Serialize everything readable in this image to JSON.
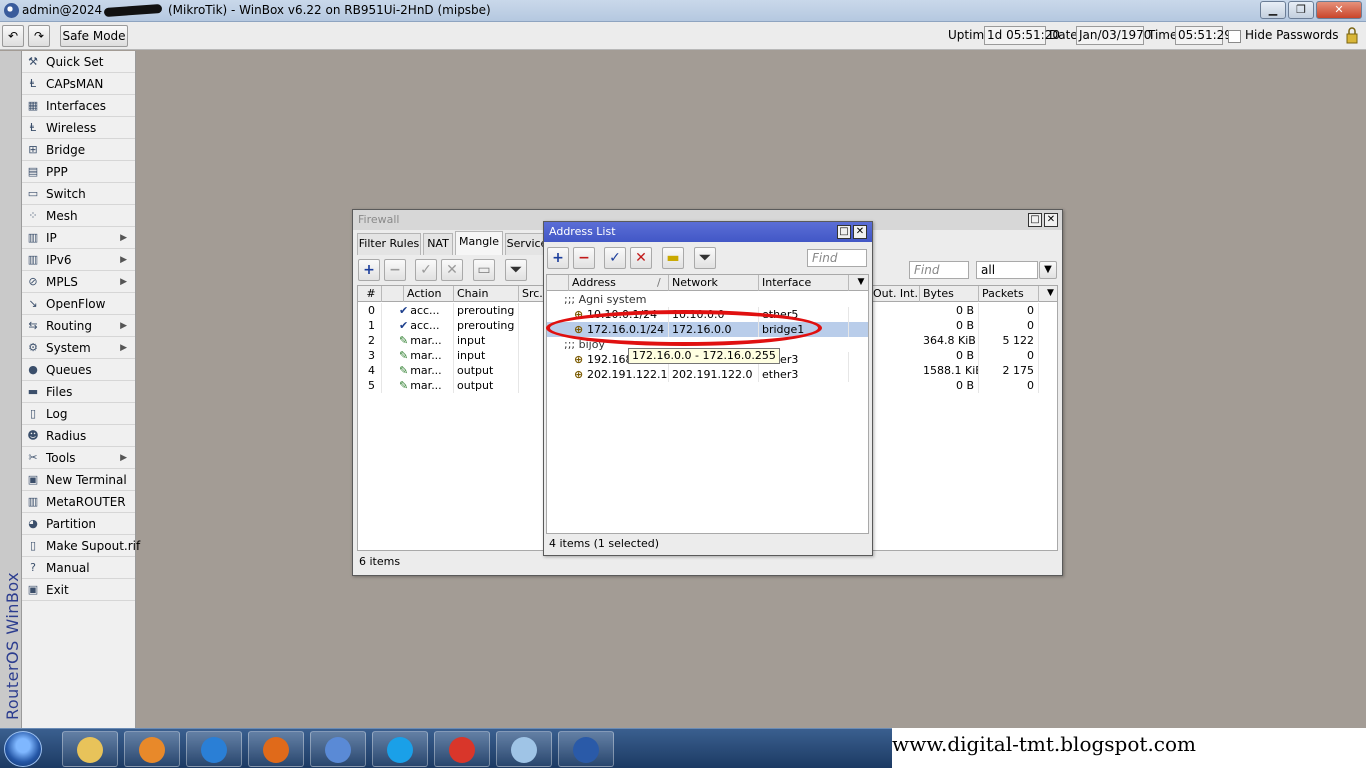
{
  "window": {
    "title_prefix": "admin@2024",
    "title_suffix": "(MikroTik) - WinBox v6.22 on RB951Ui-2HnD (mipsbe)",
    "btn_min": "▁",
    "btn_max": "❐",
    "btn_close": "✕"
  },
  "toolbar": {
    "undo_icon": "undo-icon",
    "redo_icon": "redo-icon",
    "undo_glyph": "↶",
    "redo_glyph": "↷",
    "safe_mode": "Safe Mode",
    "uptime_label": "Uptime:",
    "uptime_value": "1d 05:51:20",
    "date_label": "Date:",
    "date_value": "Jan/03/1970",
    "time_label": "Time:",
    "time_value": "05:51:29",
    "hide_passwords": "Hide Passwords"
  },
  "brand": {
    "text": "RouterOS WinBox"
  },
  "sidebar": {
    "items": [
      {
        "label": "Quick Set",
        "icon": "quick-set-icon",
        "glyph": "⚒"
      },
      {
        "label": "CAPsMAN",
        "icon": "capsman-icon",
        "glyph": "Ⱡ"
      },
      {
        "label": "Interfaces",
        "icon": "interfaces-icon",
        "glyph": "▦"
      },
      {
        "label": "Wireless",
        "icon": "wireless-icon",
        "glyph": "Ⱡ"
      },
      {
        "label": "Bridge",
        "icon": "bridge-icon",
        "glyph": "⊞"
      },
      {
        "label": "PPP",
        "icon": "ppp-icon",
        "glyph": "▤"
      },
      {
        "label": "Switch",
        "icon": "switch-icon",
        "glyph": "▭"
      },
      {
        "label": "Mesh",
        "icon": "mesh-icon",
        "glyph": "⁘"
      },
      {
        "label": "IP",
        "icon": "ip-icon",
        "glyph": "▥",
        "arrow": "▶"
      },
      {
        "label": "IPv6",
        "icon": "ipv6-icon",
        "glyph": "▥",
        "arrow": "▶"
      },
      {
        "label": "MPLS",
        "icon": "mpls-icon",
        "glyph": "⊘",
        "arrow": "▶"
      },
      {
        "label": "OpenFlow",
        "icon": "openflow-icon",
        "glyph": "↘"
      },
      {
        "label": "Routing",
        "icon": "routing-icon",
        "glyph": "⇆",
        "arrow": "▶"
      },
      {
        "label": "System",
        "icon": "system-icon",
        "glyph": "⚙",
        "arrow": "▶"
      },
      {
        "label": "Queues",
        "icon": "queues-icon",
        "glyph": "●"
      },
      {
        "label": "Files",
        "icon": "files-icon",
        "glyph": "▬"
      },
      {
        "label": "Log",
        "icon": "log-icon",
        "glyph": "▯"
      },
      {
        "label": "Radius",
        "icon": "radius-icon",
        "glyph": "☻"
      },
      {
        "label": "Tools",
        "icon": "tools-icon",
        "glyph": "✂",
        "arrow": "▶"
      },
      {
        "label": "New Terminal",
        "icon": "terminal-icon",
        "glyph": "▣"
      },
      {
        "label": "MetaROUTER",
        "icon": "metarouter-icon",
        "glyph": "▥"
      },
      {
        "label": "Partition",
        "icon": "partition-icon",
        "glyph": "◕"
      },
      {
        "label": "Make Supout.rif",
        "icon": "supout-icon",
        "glyph": "▯"
      },
      {
        "label": "Manual",
        "icon": "manual-icon",
        "glyph": "?"
      },
      {
        "label": "Exit",
        "icon": "exit-icon",
        "glyph": "▣"
      }
    ]
  },
  "firewall": {
    "title": "Firewall",
    "tabs": [
      "Filter Rules",
      "NAT",
      "Mangle",
      "Service"
    ],
    "active_tab": "Mangle",
    "find_placeholder": "Find",
    "filter_select": "all",
    "columns": [
      "#",
      "Action",
      "Chain",
      "Src.",
      "Out. Int...",
      "Bytes",
      "Packets"
    ],
    "rows": [
      {
        "num": "0",
        "action": "acc...",
        "action_type": "accept",
        "chain": "prerouting",
        "bytes": "0 B",
        "packets": "0"
      },
      {
        "num": "1",
        "action": "acc...",
        "action_type": "accept",
        "chain": "prerouting",
        "bytes": "0 B",
        "packets": "0"
      },
      {
        "num": "2",
        "action": "mar...",
        "action_type": "mark",
        "chain": "input",
        "bytes": "364.8 KiB",
        "packets": "5 122"
      },
      {
        "num": "3",
        "action": "mar...",
        "action_type": "mark",
        "chain": "input",
        "bytes": "0 B",
        "packets": "0"
      },
      {
        "num": "4",
        "action": "mar...",
        "action_type": "mark",
        "chain": "output",
        "bytes": "1588.1 KiB",
        "packets": "2 175"
      },
      {
        "num": "5",
        "action": "mar...",
        "action_type": "mark",
        "chain": "output",
        "bytes": "0 B",
        "packets": "0"
      }
    ],
    "status": "6 items"
  },
  "address_list": {
    "title": "Address List",
    "find_placeholder": "Find",
    "columns": [
      "Address",
      "Network",
      "Interface"
    ],
    "sort_indicator": "/",
    "rows": [
      {
        "type": "comment",
        "text": ";;; Agni system"
      },
      {
        "type": "item",
        "address": "10.10.0.1/24",
        "network": "10.10.0.0",
        "interface": "ether5"
      },
      {
        "type": "item",
        "address": "172.16.0.1/24",
        "network": "172.16.0.0",
        "interface": "bridge1",
        "selected": true
      },
      {
        "type": "comment",
        "text": ";;; bijoy"
      },
      {
        "type": "item",
        "address": "192.168",
        "network": "",
        "interface": "ether3"
      },
      {
        "type": "item",
        "address": "202.191.122.1...",
        "network": "202.191.122.0",
        "interface": "ether3"
      }
    ],
    "tooltip": "172.16.0.0 - 172.16.0.255",
    "status": "4 items (1 selected)"
  },
  "taskbar": {
    "apps": [
      {
        "name": "windows-explorer-icon",
        "color": "#e8c35a"
      },
      {
        "name": "media-player-icon",
        "color": "#e8892a"
      },
      {
        "name": "maxthon-icon",
        "color": "#2a7fd6"
      },
      {
        "name": "firefox-icon",
        "color": "#e06a1a"
      },
      {
        "name": "globe-icon",
        "color": "#5a8ad6"
      },
      {
        "name": "skype-icon",
        "color": "#1aa0e8"
      },
      {
        "name": "chrome-icon",
        "color": "#d9362a"
      },
      {
        "name": "notepad-icon",
        "color": "#9fc4e6"
      },
      {
        "name": "winbox-icon",
        "color": "#2a5aa8"
      }
    ]
  },
  "watermark": "www.digital-tmt.blogspot.com",
  "colors": {
    "brand_blue": "#2c3d8f",
    "selection": "#b9cdea",
    "highlight_ellipse": "#e01010",
    "desktop": "#a39c95"
  }
}
